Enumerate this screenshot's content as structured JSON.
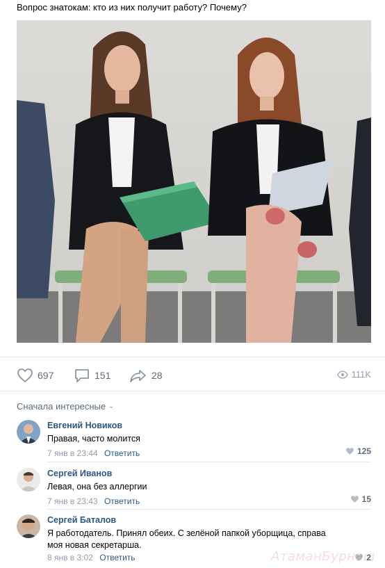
{
  "post": {
    "text": "Вопрос знатокам: кто из них получит работу? Почему?"
  },
  "actions": {
    "likes": "697",
    "comments": "151",
    "shares": "28",
    "views": "111K"
  },
  "comments_sort": {
    "label": "Сначала интересные"
  },
  "comments": [
    {
      "author": "Евгений Новиков",
      "text": "Правая, часто молится",
      "date": "7 янв в 23:44",
      "reply_label": "Ответить",
      "likes": "125"
    },
    {
      "author": "Сергей Иванов",
      "text": "Левая, она без аллергии",
      "date": "7 янв в 23:43",
      "reply_label": "Ответить",
      "likes": "15"
    },
    {
      "author": "Сергей Баталов",
      "text": "Я работодатель. Принял обеих. С зелёной папкой уборщица, справа моя новая секретарша.",
      "date": "8 янв в 3:02",
      "reply_label": "Ответить",
      "likes": "2"
    }
  ],
  "watermark": "АтаманБурнаш",
  "icons": {
    "like": "heart-icon",
    "comment": "comment-bubble-icon",
    "share": "share-arrow-icon",
    "views": "eye-icon",
    "sort": "chevron-down-icon"
  },
  "colors": {
    "link": "#2a5885",
    "muted": "#939cab",
    "action": "#5d6b7d",
    "folder": "#3f9b6d"
  }
}
